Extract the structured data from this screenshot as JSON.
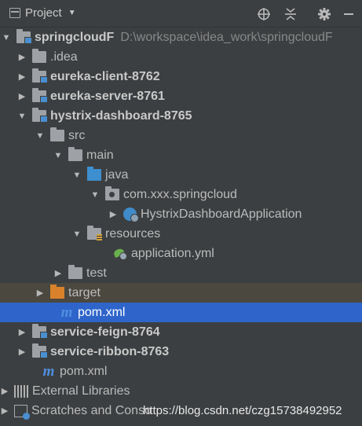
{
  "toolbar": {
    "title": "Project",
    "icons": [
      "crosshair-icon",
      "collapse-icon",
      "gear-icon",
      "minimize-icon"
    ]
  },
  "tree": [
    {
      "label": "springcloudF",
      "path": "D:\\workspace\\idea_work\\springcloudF",
      "bold": true,
      "expanded": true,
      "icon": "module-folder-icon"
    },
    {
      "label": ".idea",
      "bold": false,
      "expanded": false,
      "icon": "folder-icon"
    },
    {
      "label": "eureka-client-8762",
      "bold": true,
      "expanded": false,
      "icon": "module-folder-icon"
    },
    {
      "label": "eureka-server-8761",
      "bold": true,
      "expanded": false,
      "icon": "module-folder-icon"
    },
    {
      "label": "hystrix-dashboard-8765",
      "bold": true,
      "expanded": true,
      "icon": "module-folder-icon"
    },
    {
      "label": "src",
      "bold": false,
      "expanded": true,
      "icon": "folder-icon"
    },
    {
      "label": "main",
      "bold": false,
      "expanded": true,
      "icon": "folder-icon"
    },
    {
      "label": "java",
      "bold": false,
      "expanded": true,
      "icon": "source-folder-icon"
    },
    {
      "label": "com.xxx.springcloud",
      "bold": false,
      "expanded": true,
      "icon": "package-icon"
    },
    {
      "label": "HystrixDashboardApplication",
      "bold": false,
      "expanded": false,
      "icon": "spring-boot-class-icon"
    },
    {
      "label": "resources",
      "bold": false,
      "expanded": true,
      "icon": "resources-folder-icon"
    },
    {
      "label": "application.yml",
      "bold": false,
      "icon": "yaml-file-icon"
    },
    {
      "label": "test",
      "bold": false,
      "expanded": false,
      "icon": "folder-icon"
    },
    {
      "label": "target",
      "bold": false,
      "expanded": false,
      "icon": "excluded-folder-icon"
    },
    {
      "label": "pom.xml",
      "bold": false,
      "icon": "maven-file-icon",
      "selected": true
    },
    {
      "label": "service-feign-8764",
      "bold": true,
      "expanded": false,
      "icon": "module-folder-icon"
    },
    {
      "label": "service-ribbon-8763",
      "bold": true,
      "expanded": false,
      "icon": "module-folder-icon"
    },
    {
      "label": "pom.xml",
      "bold": false,
      "icon": "maven-file-icon"
    },
    {
      "label": "External Libraries",
      "bold": false,
      "expanded": false,
      "icon": "libraries-icon"
    },
    {
      "label": "Scratches and Conso",
      "bold": false,
      "expanded": false,
      "icon": "scratches-icon"
    }
  ],
  "watermark": "https://blog.csdn.net/czg15738492952",
  "colors": {
    "background": "#3c3f41",
    "selection": "#2f65ca",
    "highlight": "#4b4840",
    "text": "#bbbbbb"
  }
}
